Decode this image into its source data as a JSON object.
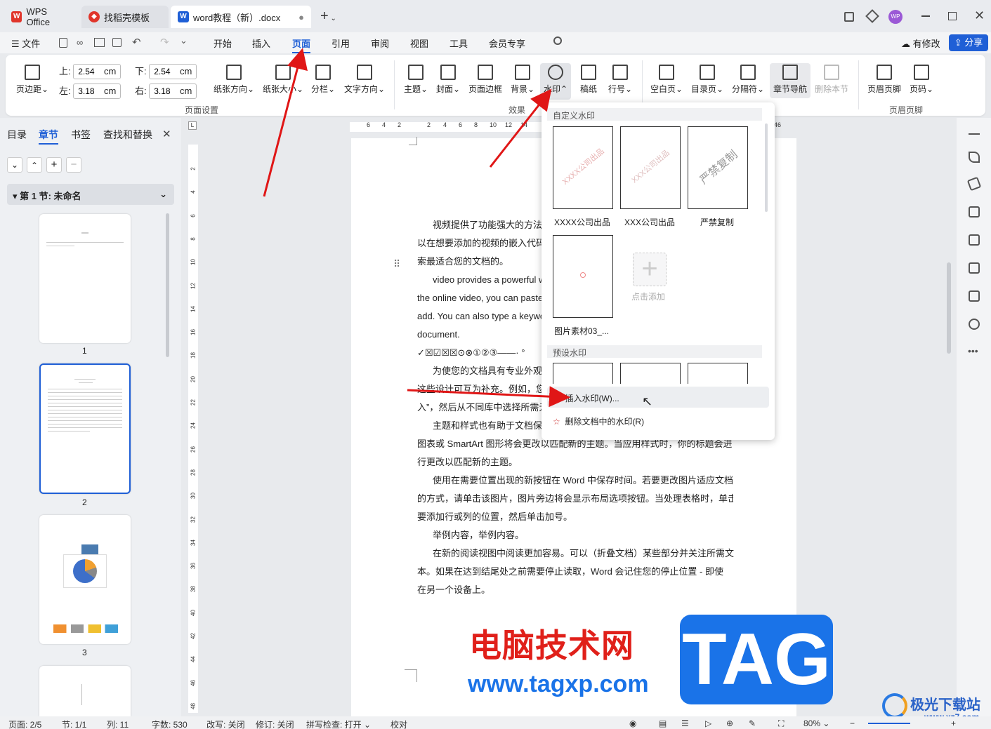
{
  "titlebar": {
    "app_tab": "WPS Office",
    "template_tab": "找稻壳模板",
    "doc_tab": "word教程（新）.docx",
    "new_tab_symbol": "+",
    "user_initials": "WP"
  },
  "menubar": {
    "file": "文件",
    "items": [
      "开始",
      "插入",
      "页面",
      "引用",
      "审阅",
      "视图",
      "工具",
      "会员专享"
    ],
    "active": "页面",
    "modified": "有修改",
    "share": "分享"
  },
  "ribbon": {
    "margin_btn": "页边距",
    "top_label": "上:",
    "top_value": "2.54",
    "bottom_label": "下:",
    "bottom_value": "2.54",
    "left_label": "左:",
    "left_value": "3.18",
    "right_label": "右:",
    "right_value": "3.18",
    "unit": "cm",
    "orientation": "纸张方向",
    "size": "纸张大小",
    "columns": "分栏",
    "text_dir": "文字方向",
    "group_page_setup": "页面设置",
    "theme": "主题",
    "cover": "封面",
    "border": "页面边框",
    "background": "背景",
    "watermark": "水印",
    "manuscript": "稿纸",
    "line_no": "行号",
    "group_effects": "效果",
    "blank_page": "空白页",
    "toc_page": "目录页",
    "separator": "分隔符",
    "chapter_nav": "章节导航",
    "delete_section": "删除本节",
    "header_footer": "页眉页脚",
    "page_no": "页码",
    "group_header_footer": "页眉页脚"
  },
  "leftpanel": {
    "tabs": [
      "目录",
      "章节",
      "书签",
      "查找和替换"
    ],
    "active_tab": "章节",
    "section_title": "第 1 节: 未命名",
    "page_numbers": [
      "1",
      "2",
      "3"
    ]
  },
  "ruler": {
    "top_ticks": [
      "6",
      "4",
      "2",
      "2",
      "4",
      "6",
      "8",
      "10",
      "12",
      "14",
      "46"
    ],
    "left_ticks": [
      "2",
      "4",
      "6",
      "8",
      "10",
      "12",
      "14",
      "16",
      "18",
      "20",
      "22",
      "24",
      "26",
      "28",
      "30",
      "32",
      "34",
      "36",
      "38",
      "40",
      "42",
      "44",
      "46",
      "48"
    ]
  },
  "document": {
    "lines": [
      "视频提供了功能强大的方法",
      "以在想要添加的视频的嵌入代码",
      "索最适合您的文档的。",
      "video provides a powerful w",
      "the online video, you can paste",
      "add. You can also type a keywor",
      "document.",
      "✓☒☑☒☒⊙⊗①②③——·    °",
      "为使您的文档具有专业外观",
      "这些设计可互为补充。例如，您",
      "入”，然后从不同库中选择所需元",
      "主题和样式也有助于文档保",
      "图表或 SmartArt 图形将会更改以匹配新的主题。当应用样式时，你的标题会进",
      "行更改以匹配新的主题。",
      "使用在需要位置出现的新按钮在 Word 中保存时间。若要更改图片适应文档",
      "的方式，请单击该图片，图片旁边将会显示布局选项按钮。当处理表格时，单击",
      "要添加行或列的位置，然后单击加号。",
      "举例内容，举例内容。",
      "在新的阅读视图中阅读更加容易。可以（折叠文档）某些部分并关注所需文",
      "本。如果在达到结尾处之前需要停止读取，Word 会记住您的停止位置 - 即使",
      "在另一个设备上。"
    ]
  },
  "watermark_menu": {
    "custom_header": "自定义水印",
    "custom_items": [
      "XXXX公司出品",
      "XXX公司出品",
      "严禁复制",
      "图片素材03_..."
    ],
    "card_texts": [
      "XXXX公司出品",
      "XXX公司出品",
      "严禁复制"
    ],
    "add_label": "点击添加",
    "preset_header": "预设水印",
    "insert": "插入水印(W)...",
    "delete": "删除文档中的水印(R)"
  },
  "overlay": {
    "site_cn": "电脑技术网",
    "site_url": "www.tagxp.com",
    "tag": "TAG",
    "brand": "极光下载站",
    "brand_url": "www.xz7.com"
  },
  "statusbar": {
    "page": "页面: 2/5",
    "section": "节: 1/1",
    "column": "列: 11",
    "words": "字数: 530",
    "overwrite": "改写: 关闭",
    "revision": "修订: 关闭",
    "spellcheck": "拼写检查: 打开",
    "proof": "校对",
    "zoom": "80%"
  },
  "colors": {
    "accent": "#1f5fd6",
    "arrow": "#e01616",
    "tag_blue": "#1a73e8",
    "wps_red": "#e0352b"
  }
}
